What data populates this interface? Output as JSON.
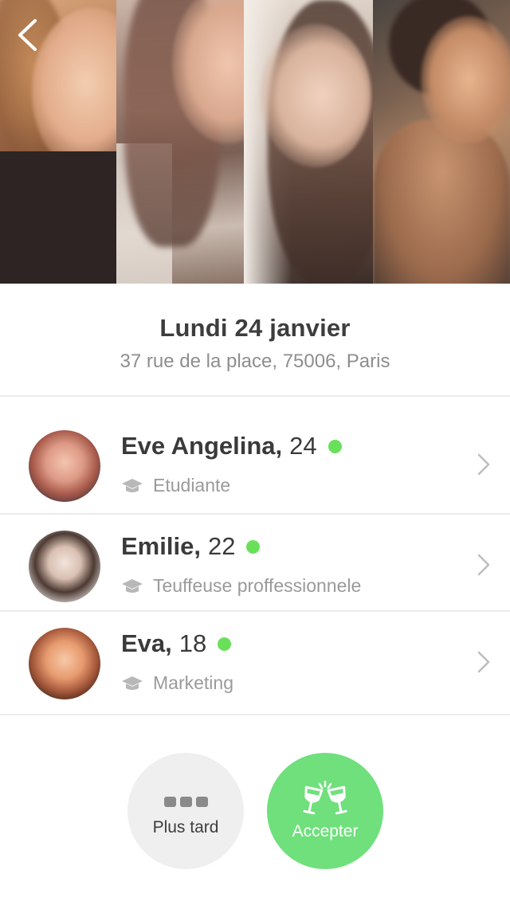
{
  "header": {
    "back_icon": "chevron-left-icon",
    "photos_count": 4
  },
  "event": {
    "date": "Lundi 24 janvier",
    "address": "37 rue de la place, 75006, Paris"
  },
  "participants": [
    {
      "name": "Eve Angelina",
      "comma": ",",
      "age": "24",
      "online": true,
      "job": "Etudiante",
      "job_icon": "graduation-cap-icon"
    },
    {
      "name": "Emilie",
      "comma": ",",
      "age": "22",
      "online": true,
      "job": "Teuffeuse proffessionnele",
      "job_icon": "graduation-cap-icon"
    },
    {
      "name": "Eva",
      "comma": ",",
      "age": "18",
      "online": true,
      "job": "Marketing",
      "job_icon": "graduation-cap-icon"
    }
  ],
  "actions": {
    "later_label": "Plus tard",
    "later_icon": "more-dots-icon",
    "accept_label": "Accepter",
    "accept_icon": "cheers-glasses-icon"
  },
  "colors": {
    "accent_green": "#6fe07c",
    "online_green": "#6ae05a",
    "text_dark": "#3a3a3a",
    "text_muted": "#9a9a9a",
    "divider": "#ececec",
    "later_bg": "#efefef"
  }
}
